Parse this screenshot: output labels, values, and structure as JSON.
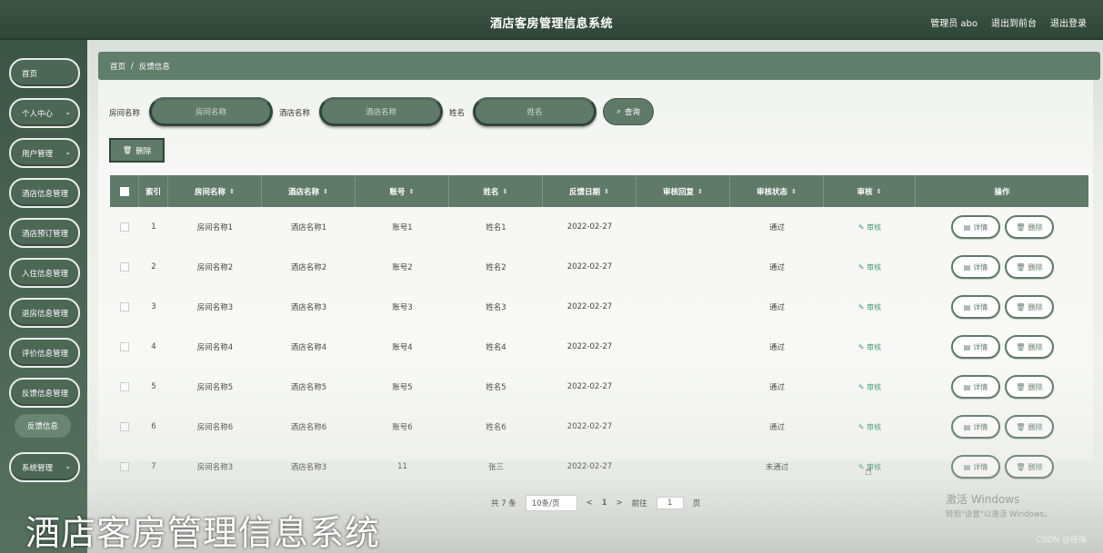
{
  "header": {
    "title": "酒店客房管理信息系统",
    "admin": "管理员 abo",
    "back_front": "退出到前台",
    "logout": "退出登录"
  },
  "sidebar": {
    "items": [
      {
        "label": "首页"
      },
      {
        "label": "个人中心"
      },
      {
        "label": "用户管理"
      },
      {
        "label": "酒店信息管理"
      },
      {
        "label": "酒店预订管理"
      },
      {
        "label": "入住信息管理"
      },
      {
        "label": "退房信息管理"
      },
      {
        "label": "评价信息管理"
      },
      {
        "label": "反馈信息管理"
      },
      {
        "label": "反馈信息"
      },
      {
        "label": "系统管理"
      }
    ]
  },
  "breadcrumb": {
    "home": "首页",
    "sep": "/",
    "current": "反馈信息"
  },
  "search": {
    "room_label": "房间名称",
    "room_placeholder": "房间名称",
    "hotel_label": "酒店名称",
    "hotel_placeholder": "酒店名称",
    "name_label": "姓名",
    "name_placeholder": "姓名",
    "query": "查询"
  },
  "actions": {
    "delete": "删除"
  },
  "table": {
    "headers": [
      "索引",
      "房间名称",
      "酒店名称",
      "账号",
      "姓名",
      "反馈日期",
      "审核回复",
      "审核状态",
      "审核",
      "操作"
    ],
    "audit_label": "审核",
    "detail_label": "详情",
    "delete_label": "删除",
    "rows": [
      {
        "idx": "1",
        "room": "房间名称1",
        "hotel": "酒店名称1",
        "account": "账号1",
        "name": "姓名1",
        "date": "2022-02-27",
        "reply": "",
        "status": "通过"
      },
      {
        "idx": "2",
        "room": "房间名称2",
        "hotel": "酒店名称2",
        "account": "账号2",
        "name": "姓名2",
        "date": "2022-02-27",
        "reply": "",
        "status": "通过"
      },
      {
        "idx": "3",
        "room": "房间名称3",
        "hotel": "酒店名称3",
        "account": "账号3",
        "name": "姓名3",
        "date": "2022-02-27",
        "reply": "",
        "status": "通过"
      },
      {
        "idx": "4",
        "room": "房间名称4",
        "hotel": "酒店名称4",
        "account": "账号4",
        "name": "姓名4",
        "date": "2022-02-27",
        "reply": "",
        "status": "通过"
      },
      {
        "idx": "5",
        "room": "房间名称5",
        "hotel": "酒店名称5",
        "account": "账号5",
        "name": "姓名5",
        "date": "2022-02-27",
        "reply": "",
        "status": "通过"
      },
      {
        "idx": "6",
        "room": "房间名称6",
        "hotel": "酒店名称6",
        "account": "账号6",
        "name": "姓名6",
        "date": "2022-02-27",
        "reply": "",
        "status": "通过"
      },
      {
        "idx": "7",
        "room": "房间名称3",
        "hotel": "酒店名称3",
        "account": "11",
        "name": "张三",
        "date": "2022-02-27",
        "reply": "",
        "status": "未通过"
      }
    ]
  },
  "pagination": {
    "total": "共 7 条",
    "page_size": "10条/页",
    "prev": "<",
    "current_page": "1",
    "next": ">",
    "goto_label": "前往",
    "goto_value": "1",
    "page_unit": "页"
  },
  "overlay": {
    "caption": "酒店客房管理信息系统",
    "windows_line1": "激活 Windows",
    "windows_line2": "转到\"设置\"以激活 Windows。",
    "watermark": "CSDN @佳倫"
  },
  "colors": {
    "header": "#2f4638",
    "accent": "#5f7a68",
    "audit_link": "#3f9a75"
  }
}
